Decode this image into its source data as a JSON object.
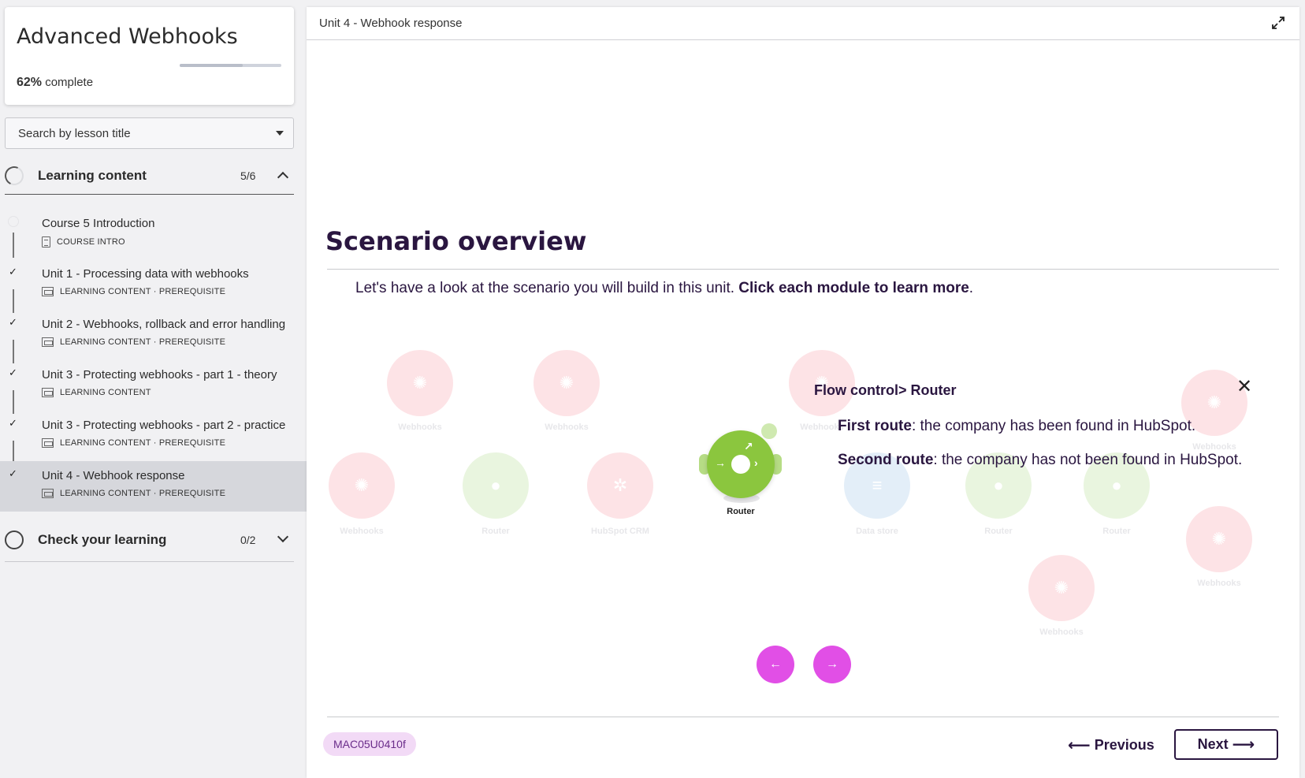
{
  "sidebar": {
    "course_title": "Advanced Webhooks",
    "progress": {
      "percent_label": "62%",
      "suffix": "complete",
      "fraction": 0.62
    },
    "search": {
      "placeholder": "Search by lesson title"
    },
    "sections": [
      {
        "label": "Learning content",
        "count": "5/6",
        "expanded": true
      },
      {
        "label": "Check your learning",
        "count": "0/2",
        "expanded": false
      }
    ],
    "lessons": [
      {
        "title": "Course 5 Introduction",
        "meta": "COURSE INTRO",
        "done": false,
        "icon": "document-icon"
      },
      {
        "title": "Unit 1 - Processing data with webhooks",
        "meta": "LEARNING CONTENT · PREREQUISITE",
        "done": true,
        "icon": "slides-icon"
      },
      {
        "title": "Unit 2 - Webhooks, rollback and error handling",
        "meta": "LEARNING CONTENT · PREREQUISITE",
        "done": true,
        "icon": "slides-icon"
      },
      {
        "title": "Unit 3 - Protecting webhooks - part 1 - theory",
        "meta": "LEARNING CONTENT",
        "done": true,
        "icon": "slides-icon"
      },
      {
        "title": "Unit 3 - Protecting webhooks - part 2 - practice",
        "meta": "LEARNING CONTENT · PREREQUISITE",
        "done": true,
        "icon": "slides-icon"
      },
      {
        "title": "Unit 4 - Webhook response",
        "meta": "LEARNING CONTENT · PREREQUISITE",
        "done": true,
        "active": true,
        "icon": "slides-icon"
      }
    ]
  },
  "main": {
    "breadcrumb": "Unit 4 - Webhook response",
    "heading": "Scenario overview",
    "intro_plain": "Let's have a look at the scenario you will build in this unit. ",
    "intro_bold": "Click each module to learn more",
    "intro_end": ".",
    "diagram": {
      "faded_labels": {
        "webhooks": "Webhooks",
        "router": "Router",
        "hubspot": "HubSpot CRM",
        "data_store": "Data store"
      },
      "router_label": "Router"
    },
    "popup": {
      "title": "Flow control> Router",
      "first_bold": "First route",
      "first_text": ": the company has been found in HubSpot.",
      "second_bold": "Second route",
      "second_text": ": the company has not been found in HubSpot."
    },
    "footer": {
      "code": "MAC05U0410f",
      "previous_label": "Previous",
      "next_label": "Next"
    }
  },
  "colors": {
    "accent_magenta": "#e14fe6",
    "heading_purple": "#2a1640",
    "router_green": "#8bc63e",
    "badge_bg": "#f2daf6"
  }
}
